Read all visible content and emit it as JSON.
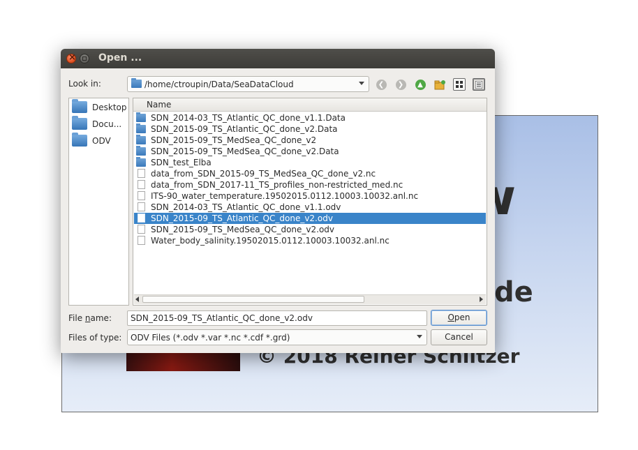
{
  "background_window": {
    "big_text": "ew",
    "mid_text": "de",
    "copyright": "© 2018 Reiner Schlitzer"
  },
  "dialog": {
    "title": "Open ...",
    "look_in_label": "Look in:",
    "look_in_path": "/home/ctroupin/Data/SeaDataCloud",
    "toolbar_icons": [
      "back-icon",
      "forward-icon",
      "up-icon",
      "new-folder-icon",
      "list-view-icon",
      "detail-view-icon"
    ],
    "sidebar": [
      {
        "label": "Desktop",
        "icon": "folder-icon"
      },
      {
        "label": "Docu...",
        "icon": "folder-icon"
      },
      {
        "label": "ODV",
        "icon": "folder-icon"
      }
    ],
    "column_header": "Name",
    "files": [
      {
        "name": "SDN_2014-03_TS_Atlantic_QC_done_v1.1.Data",
        "type": "folder"
      },
      {
        "name": "SDN_2015-09_TS_Atlantic_QC_done_v2.Data",
        "type": "folder"
      },
      {
        "name": "SDN_2015-09_TS_MedSea_QC_done_v2",
        "type": "folder"
      },
      {
        "name": "SDN_2015-09_TS_MedSea_QC_done_v2.Data",
        "type": "folder"
      },
      {
        "name": "SDN_test_Elba",
        "type": "folder"
      },
      {
        "name": "data_from_SDN_2015-09_TS_MedSea_QC_done_v2.nc",
        "type": "file"
      },
      {
        "name": "data_from_SDN_2017-11_TS_profiles_non-restricted_med.nc",
        "type": "file"
      },
      {
        "name": "ITS-90_water_temperature.19502015.0112.10003.10032.anl.nc",
        "type": "file"
      },
      {
        "name": "SDN_2014-03_TS_Atlantic_QC_done_v1.1.odv",
        "type": "file"
      },
      {
        "name": "SDN_2015-09_TS_Atlantic_QC_done_v2.odv",
        "type": "file",
        "selected": true
      },
      {
        "name": "SDN_2015-09_TS_MedSea_QC_done_v2.odv",
        "type": "file"
      },
      {
        "name": "Water_body_salinity.19502015.0112.10003.10032.anl.nc",
        "type": "file"
      }
    ],
    "file_name_label_pre": "File ",
    "file_name_label_mnemonic": "n",
    "file_name_label_post": "ame:",
    "file_name_value": "SDN_2015-09_TS_Atlantic_QC_done_v2.odv",
    "file_type_label": "Files of type:",
    "file_type_value": "ODV Files (*.odv *.var *.nc *.cdf *.grd)",
    "open_button_mnemonic": "O",
    "open_button_rest": "pen",
    "cancel_button": "Cancel",
    "colors": {
      "selection": "#3a84c9",
      "titlebar": "#3d3c38",
      "close_button": "#e15324"
    }
  }
}
